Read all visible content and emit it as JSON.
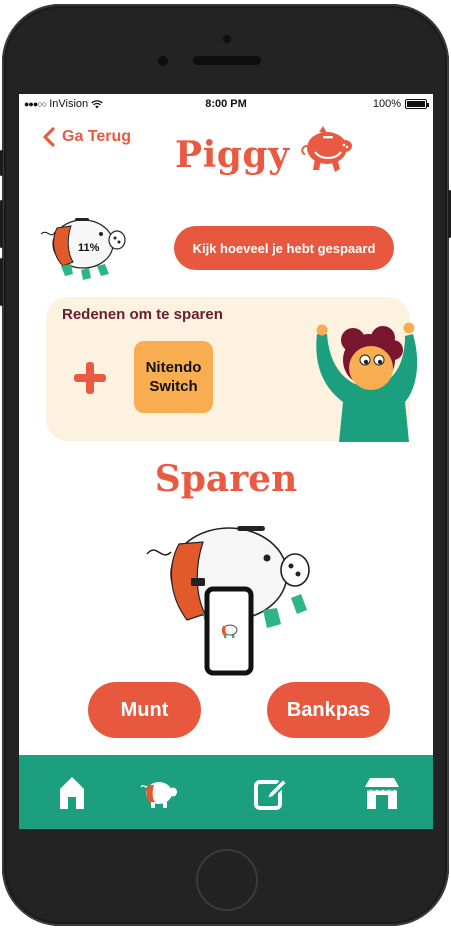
{
  "status_bar": {
    "carrier": "InVision",
    "time": "8:00 PM",
    "battery": "100%"
  },
  "header": {
    "back_label": "Ga Terug",
    "title": "Piggy"
  },
  "savings": {
    "percent": "11%",
    "percent_value": 11,
    "button_label": "Kijk hoeveel je hebt gespaard"
  },
  "reasons": {
    "title": "Redenen om te sparen",
    "goals": [
      {
        "line1": "Nitendo",
        "line2": "Switch"
      }
    ]
  },
  "saving_section": {
    "title": "Sparen",
    "buttons": {
      "coin": "Munt",
      "card": "Bankpas"
    }
  },
  "tab_bar": {
    "items": [
      "home-icon",
      "piggy-icon",
      "edit-icon",
      "shop-icon"
    ]
  },
  "colors": {
    "accent": "#e85a42",
    "button": "#e8583f",
    "card_bg": "#fdf1e0",
    "goal_tile": "#f8ad50",
    "tab_bar": "#1c9f7e",
    "heading_dark": "#6a1d2c"
  }
}
